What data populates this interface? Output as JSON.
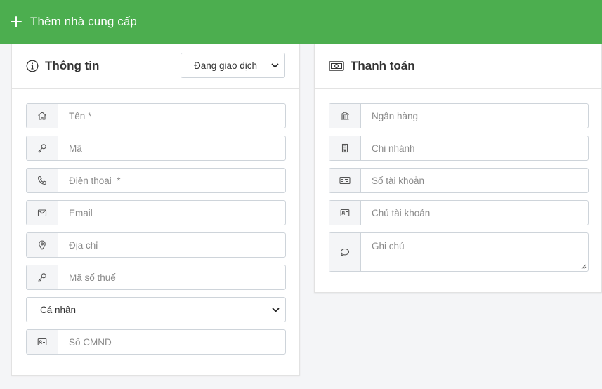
{
  "header": {
    "title": "Thêm nhà cung cấp",
    "plus_icon": "plus-icon"
  },
  "info_panel": {
    "title": "Thông tin",
    "icon": "info-circle-icon",
    "status_select": {
      "value": "Đang giao dịch"
    },
    "fields": {
      "name": {
        "placeholder": "Tên *",
        "icon": "home-icon"
      },
      "code": {
        "placeholder": "Mã",
        "icon": "key-icon"
      },
      "phone": {
        "placeholder": "Điện thoại  *",
        "icon": "phone-icon"
      },
      "email": {
        "placeholder": "Email",
        "icon": "envelope-icon"
      },
      "address": {
        "placeholder": "Địa chỉ",
        "icon": "map-pin-icon"
      },
      "tax_code": {
        "placeholder": "Mã số thuế",
        "icon": "key-icon"
      },
      "id_number": {
        "placeholder": "Số CMND",
        "icon": "id-card-icon"
      }
    },
    "type_select": {
      "value": "Cá nhân"
    }
  },
  "payment_panel": {
    "title": "Thanh toán",
    "icon": "money-bill-icon",
    "fields": {
      "bank": {
        "placeholder": "Ngân hàng",
        "icon": "bank-icon"
      },
      "branch": {
        "placeholder": "Chi nhánh",
        "icon": "building-icon"
      },
      "account_number": {
        "placeholder": "Số tài khoản",
        "icon": "credit-card-icon"
      },
      "account_holder": {
        "placeholder": "Chủ tài khoản",
        "icon": "id-card-icon"
      },
      "note": {
        "placeholder": "Ghi chú",
        "icon": "comment-icon"
      }
    }
  }
}
